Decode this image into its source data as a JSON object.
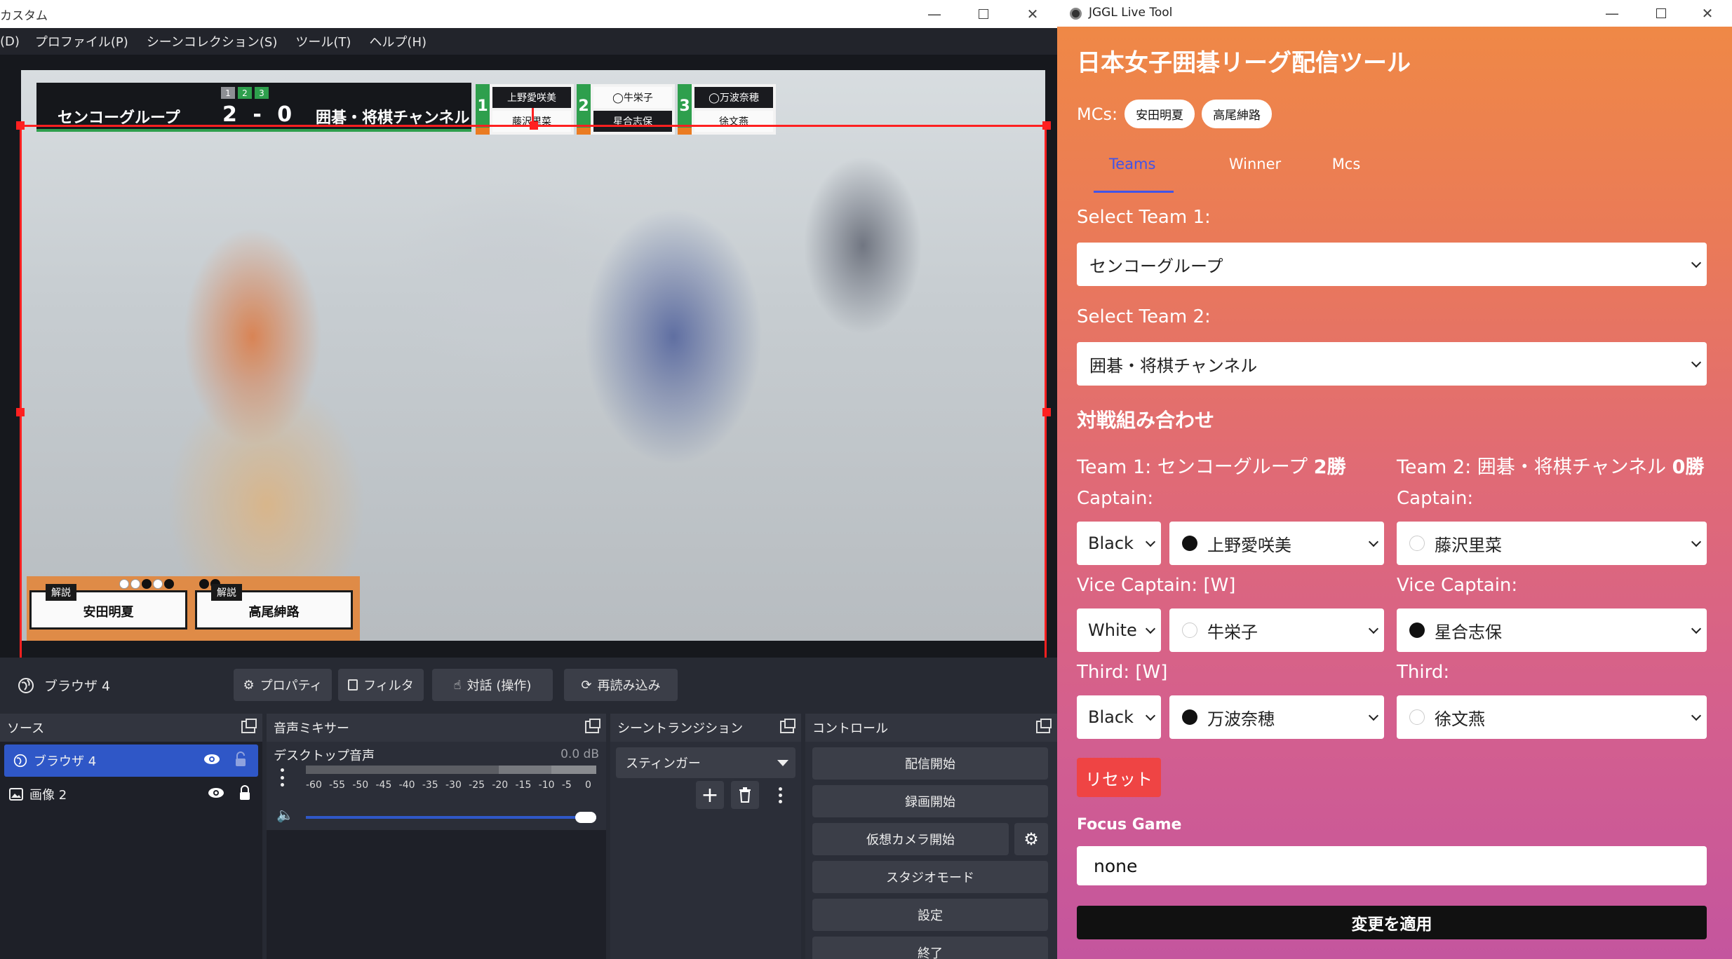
{
  "obs": {
    "title": "カスタム",
    "menu": [
      "(D)",
      "プロファイル(P)",
      "シーンコレクション(S)",
      "ツール(T)",
      "ヘルプ(H)"
    ],
    "scoreboard": {
      "boards": [
        "1",
        "2",
        "3"
      ],
      "team1": "センコーグループ",
      "score": "2 - 0",
      "team2": "囲碁・将棋チャンネル",
      "cards": [
        {
          "num": "1",
          "p1": "上野愛咲美",
          "p2": "藤沢里菜"
        },
        {
          "num": "2",
          "p1": "◯牛栄子",
          "p2": "星合志保"
        },
        {
          "num": "3",
          "p1": "◯万波奈穂",
          "p2": "徐文燕"
        }
      ]
    },
    "commentators": {
      "tag": "解説",
      "names": [
        "安田明夏",
        "高尾紳路"
      ]
    },
    "toolbar": {
      "source": "ブラウザ 4",
      "buttons": [
        "プロパティ",
        "フィルタ",
        "対話 (操作)",
        "再読み込み"
      ]
    },
    "docks": {
      "sources": {
        "header": "ソース",
        "items": [
          "ブラウザ 4",
          "画像 2"
        ]
      },
      "mixer": {
        "header": "音声ミキサー",
        "channel": "デスクトップ音声",
        "db": "0.0 dB",
        "ticks": [
          "-60",
          "-55",
          "-50",
          "-45",
          "-40",
          "-35",
          "-30",
          "-25",
          "-20",
          "-15",
          "-10",
          "-5",
          "0"
        ],
        "volume_fraction": 1.0
      },
      "transitions": {
        "header": "シーントランジション",
        "selected": "スティンガー"
      },
      "controls": {
        "header": "コントロール",
        "buttons": [
          "配信開始",
          "録画開始",
          "仮想カメラ開始",
          "スタジオモード",
          "設定",
          "終了"
        ]
      }
    }
  },
  "jggl": {
    "title": "JGGL Live Tool",
    "heading": "日本女子囲碁リーグ配信ツール",
    "mcs_label": "MCs:",
    "mcs": [
      "安田明夏",
      "高尾紳路"
    ],
    "tabs": [
      "Teams",
      "Winner",
      "Mcs"
    ],
    "active_tab": "Teams",
    "select_team1_label": "Select Team 1:",
    "select_team1_value": "センコーグループ",
    "select_team2_label": "Select Team 2:",
    "select_team2_value": "囲碁・将棋チャンネル",
    "matchups_heading": "対戦組み合わせ",
    "team1": {
      "prefix": "Team 1: センコーグループ",
      "wins": "2勝"
    },
    "team2": {
      "prefix": "Team 2: 囲碁・将棋チャンネル",
      "wins": "0勝"
    },
    "rows": [
      {
        "label1": "Captain:",
        "label2": "Captain:",
        "color": "Black",
        "p1": "上野愛咲美",
        "p1_stone": "black",
        "p2": "藤沢里菜",
        "p2_stone": "white"
      },
      {
        "label1": "Vice Captain: [W]",
        "label2": "Vice Captain:",
        "color": "White",
        "p1": "牛栄子",
        "p1_stone": "white",
        "p2": "星合志保",
        "p2_stone": "black"
      },
      {
        "label1": "Third: [W]",
        "label2": "Third:",
        "color": "Black",
        "p1": "万波奈穂",
        "p1_stone": "black",
        "p2": "徐文燕",
        "p2_stone": "white"
      }
    ],
    "reset": "リセット",
    "focus_label": "Focus Game",
    "focus_value": "none",
    "apply": "変更を適用"
  }
}
